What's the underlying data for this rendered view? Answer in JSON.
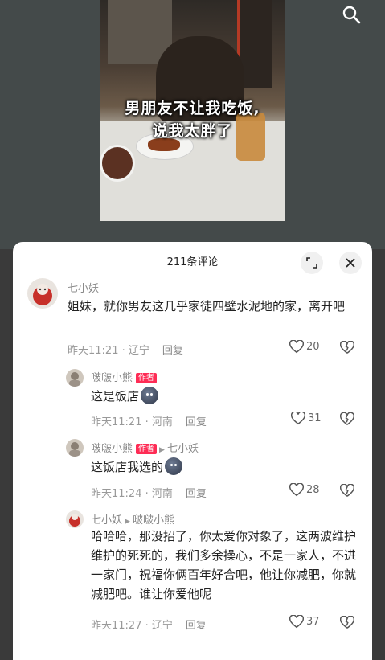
{
  "video": {
    "caption_line1": "男朋友不让我吃饭,",
    "caption_line2": "说我太胖了"
  },
  "panel": {
    "title": "211条评论"
  },
  "comments": [
    {
      "author": "七小妖",
      "text": "姐妹，就你男友这几乎家徒四壁水泥地的家，离开吧",
      "time": "昨天11:21 · 辽宁",
      "reply": "回复",
      "likes": "20"
    },
    {
      "author": "啵啵小熊",
      "badge": "作者",
      "text": "这是饭店",
      "time": "昨天11:21 · 河南",
      "reply": "回复",
      "likes": "31"
    },
    {
      "author": "啵啵小熊",
      "badge": "作者",
      "reply_to": "七小妖",
      "text": "这饭店我选的",
      "time": "昨天11:24 · 河南",
      "reply": "回复",
      "likes": "28"
    },
    {
      "author": "七小妖",
      "reply_to": "啵啵小熊",
      "text": "哈哈哈，那没招了，你太爱你对象了，这两波维护维护的死死的，我们多余操心，不是一家人，不进一家门，祝福你俩百年好合吧，他让你减肥，你就减肥吧。谁让你爱他呢",
      "time": "昨天11:27 · 辽宁",
      "reply": "回复",
      "likes": "37"
    }
  ],
  "colors": {
    "accent": "#fe2c55",
    "meta": "#999999"
  },
  "icons": [
    "search-icon",
    "expand-icon",
    "close-icon",
    "heart-icon",
    "broken-heart-icon",
    "play-triangle-icon"
  ]
}
